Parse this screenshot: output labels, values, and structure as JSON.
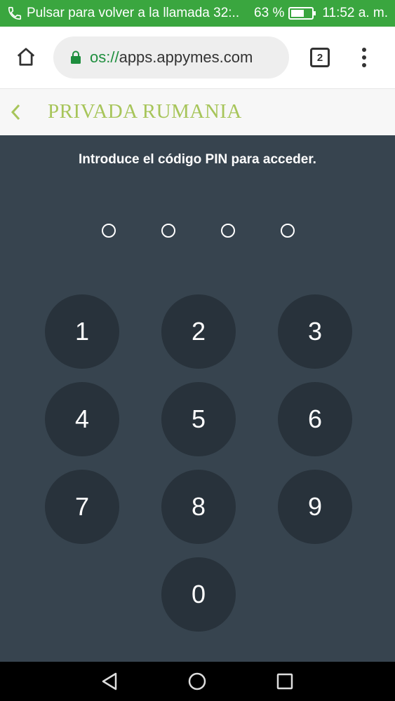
{
  "status_bar": {
    "call_text": "Pulsar para volver a la llamada 32:..",
    "battery": "63 %",
    "battery_level": 0.63,
    "time": "11:52 a. m.",
    "icons": [
      "phone-icon",
      "battery-icon"
    ]
  },
  "browser": {
    "url_scheme": "os://",
    "url_host": "apps.appymes.com",
    "tab_count": "2",
    "icons": [
      "home-icon",
      "lock-icon",
      "tabs-icon",
      "more-vert-icon"
    ]
  },
  "app_header": {
    "title": "PRIVADA RUMANIA",
    "title_color": "#a7c55a",
    "icons": [
      "chevron-left-icon"
    ]
  },
  "pin_screen": {
    "prompt": "Introduce el código PIN para acceder.",
    "pin_length": 4,
    "keys": [
      "1",
      "2",
      "3",
      "4",
      "5",
      "6",
      "7",
      "8",
      "9",
      "0"
    ],
    "background_color": "#37444f",
    "key_color": "#28323b"
  },
  "nav_bar": {
    "icons": [
      "back-triangle-icon",
      "home-circle-icon",
      "recents-square-icon"
    ]
  }
}
